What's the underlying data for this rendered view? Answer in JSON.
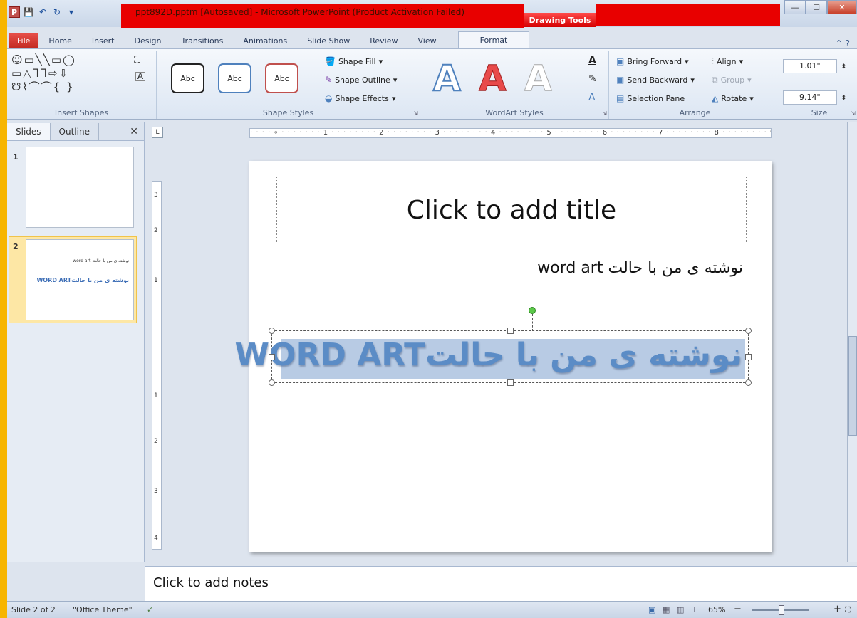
{
  "window": {
    "title": "ppt892D.pptm [Autosaved] - Microsoft PowerPoint (Product Activation Failed)",
    "contextual_tab_group": "Drawing Tools",
    "controls": {
      "minimize": "—",
      "maximize": "☐",
      "close": "✕"
    }
  },
  "quick_access": {
    "save_icon": "💾",
    "undo_icon": "↶",
    "redo_icon": "↻",
    "more_icon": "▾"
  },
  "tabs": [
    {
      "label": "File"
    },
    {
      "label": "Home"
    },
    {
      "label": "Insert"
    },
    {
      "label": "Design"
    },
    {
      "label": "Transitions"
    },
    {
      "label": "Animations"
    },
    {
      "label": "Slide Show"
    },
    {
      "label": "Review"
    },
    {
      "label": "View"
    },
    {
      "label": "Format"
    }
  ],
  "ribbon": {
    "insert_shapes": {
      "label": "Insert Shapes",
      "gallery": "☺▭╲╲▭◯\n▭△ᒣᒣ⇨⇩\n☋⌇⌒⌒{ }"
    },
    "shape_styles": {
      "label": "Shape Styles",
      "styles": [
        "Abc",
        "Abc",
        "Abc"
      ],
      "fill": "Shape Fill",
      "outline": "Shape Outline",
      "effects": "Shape Effects"
    },
    "wordart_styles": {
      "label": "WordArt Styles",
      "samples": [
        "A",
        "A",
        "A"
      ]
    },
    "arrange": {
      "label": "Arrange",
      "bring_forward": "Bring Forward",
      "send_backward": "Send Backward",
      "selection_pane": "Selection Pane",
      "align": "Align",
      "group": "Group",
      "rotate": "Rotate"
    },
    "size": {
      "label": "Size",
      "height": "1.01\"",
      "width": "9.14\""
    }
  },
  "left_pane": {
    "tabs": [
      "Slides",
      "Outline"
    ],
    "close": "✕",
    "thumbnails": [
      {
        "number": "1"
      },
      {
        "number": "2",
        "line1": "نوشته ی من با حالت word art",
        "line2": "نوشته ی من با حالتWORD ART"
      }
    ]
  },
  "ruler": {
    "corner": "L",
    "horizontal": "· · · · ⌖ · · · · · · · 1 · · · · · · · · 2 · · · · · · · · 3 · · · · · · · · 4 · · · · · · · · 5 · · · · · · · · 6 · · · · · · · · 7 · · · · · · · · 8 · · · · · · · · 9 · · ·",
    "vertical_marks": [
      "3",
      "2",
      "1",
      "1",
      "2",
      "3",
      "4"
    ]
  },
  "slide": {
    "title_placeholder": "Click to add title",
    "body_text": "نوشته ی من با حالت word art",
    "wordart_text": "نوشته ی من با حالتWORD ART"
  },
  "notes": {
    "placeholder": "Click to add notes"
  },
  "status": {
    "slide": "Slide 2 of 2",
    "theme": "\"Office Theme\"",
    "zoom": "65%",
    "zoom_out": "−",
    "zoom_in": "+"
  },
  "colors": {
    "accent_red": "#e80000",
    "wordart_blue": "#5b8cc6",
    "selection_blue": "#b8cbe4",
    "frame_yellow": "#f7b500"
  }
}
